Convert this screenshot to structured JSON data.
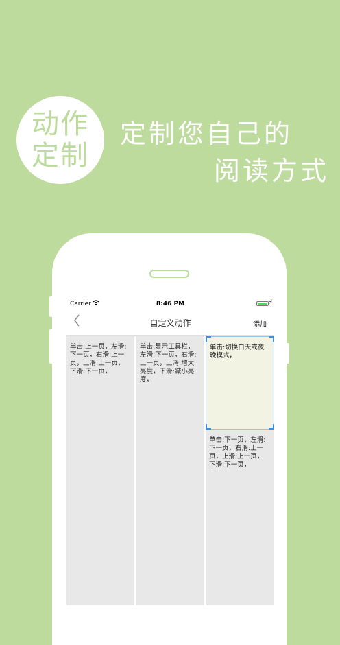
{
  "promo": {
    "badge_line1": "动作",
    "badge_line2": "定制",
    "slogan_line1": "定制您自己的",
    "slogan_line2": "阅读方式"
  },
  "status_bar": {
    "carrier": "Carrier",
    "time": "8:46 PM",
    "wifi_icon": "wifi-icon",
    "battery_icon": "battery-icon"
  },
  "nav": {
    "back_icon": "chevron-left-icon",
    "title": "自定义动作",
    "add_label": "添加"
  },
  "columns": [
    {
      "text": "单击:上一页，左滑:\n下一页，右滑:上一\n页，上滑:上一页，\n下滑:下一页，"
    },
    {
      "text": "单击:显示工具栏，\n左滑:下一页，右滑:\n上一页，上滑:增大\n亮度，下滑:减小亮\n度，"
    },
    {
      "selected_text": "单击:切换白天或夜\n晚模式，",
      "text": "单击:下一页，左滑:\n下一页，右滑:上一\n页，上滑:上一页，\n下滑:下一页，"
    }
  ],
  "colors": {
    "background": "#bddb9c",
    "selection_fill": "#f3f3e3",
    "selection_handle": "#3b8ee0",
    "column_bg": "#e8e8e8"
  }
}
